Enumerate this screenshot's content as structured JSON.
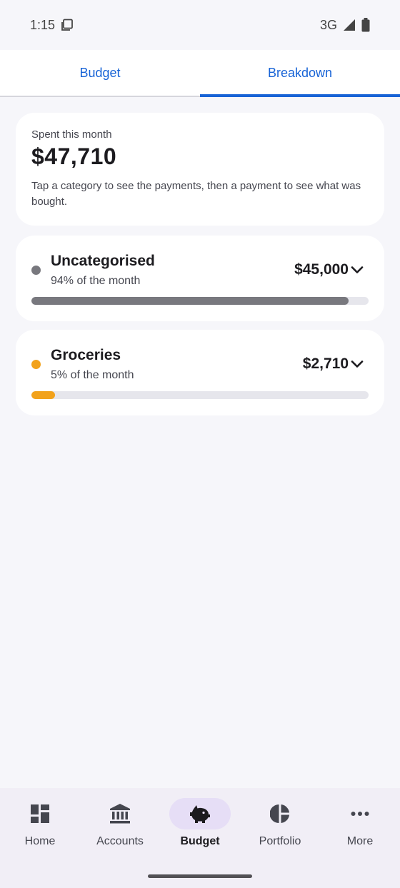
{
  "status_bar": {
    "time": "1:15",
    "network": "3G"
  },
  "tabs": [
    {
      "label": "Budget",
      "active": false
    },
    {
      "label": "Breakdown",
      "active": true
    }
  ],
  "summary": {
    "label": "Spent this month",
    "total": "$47,710",
    "hint": "Tap a category to see the payments, then a payment to see what was bought."
  },
  "categories": [
    {
      "name": "Uncategorised",
      "percent_text": "94% of the month",
      "amount": "$45,000",
      "share": 0.94,
      "color": "#78787e"
    },
    {
      "name": "Groceries",
      "percent_text": "5% of the month",
      "amount": "$2,710",
      "share": 0.05,
      "color": "#f2a21b"
    }
  ],
  "nav": [
    {
      "label": "Home",
      "icon": "dashboard-icon",
      "active": false
    },
    {
      "label": "Accounts",
      "icon": "bank-icon",
      "active": false
    },
    {
      "label": "Budget",
      "icon": "piggy-bank-icon",
      "active": true
    },
    {
      "label": "Portfolio",
      "icon": "pie-chart-icon",
      "active": false
    },
    {
      "label": "More",
      "icon": "more-horizontal-icon",
      "active": false
    }
  ],
  "colors": {
    "accent": "#1763d6",
    "nav_active_pill": "#e6def6"
  }
}
